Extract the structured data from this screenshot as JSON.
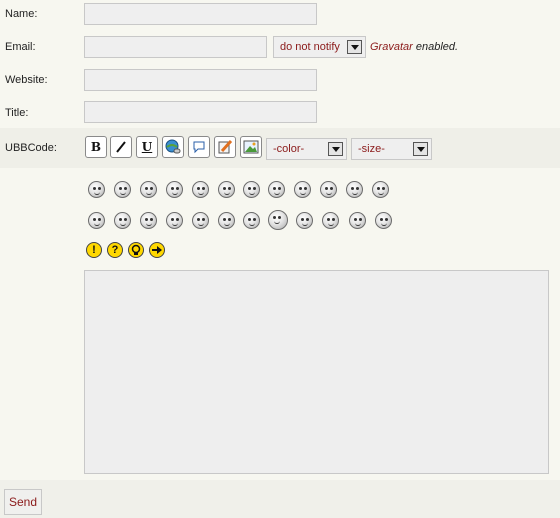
{
  "form": {
    "name_label": "Name:",
    "email_label": "Email:",
    "website_label": "Website:",
    "title_label": "Title:",
    "ubb_label": "UBBCode:",
    "notify_select_value": "do not notify",
    "gravatar_link": "Gravatar",
    "gravatar_text": " enabled.",
    "send_label": "Send"
  },
  "toolbar": {
    "bold": "B",
    "italic": "I",
    "underline": "U",
    "color_select": "-color-",
    "size_select": "-size-"
  },
  "smileys_row1": [
    "angry",
    "cool",
    "sleepy",
    "grin",
    "glasses",
    "devil",
    "wink",
    "rolleyes",
    "lol",
    "blush",
    "laugh",
    "dead"
  ],
  "smileys_row2": [
    "sad",
    "shocked",
    "confused",
    "neutral",
    "smile",
    "tongue",
    "cheeky",
    "excited",
    "whistle",
    "thinking",
    "shy",
    "dizzy"
  ],
  "symbols": [
    "!",
    "?",
    "idea",
    "arrow"
  ]
}
